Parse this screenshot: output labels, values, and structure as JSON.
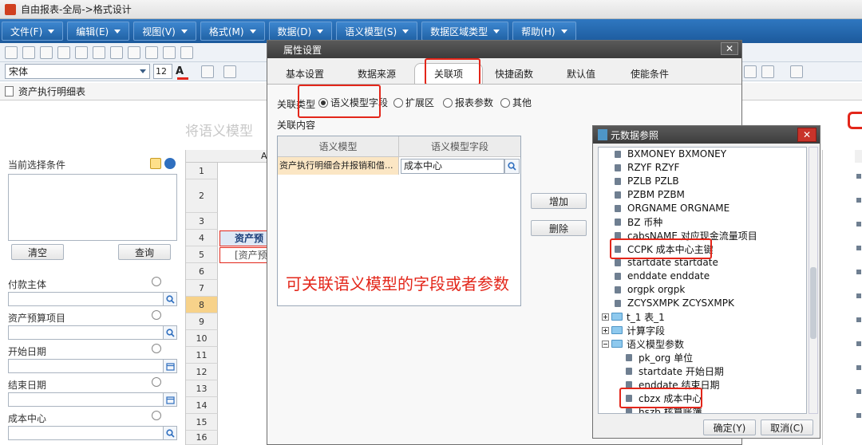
{
  "window": {
    "title": "自由报表-全局->格式设计"
  },
  "menu": [
    {
      "label": "文件(F)"
    },
    {
      "label": "编辑(E)"
    },
    {
      "label": "视图(V)"
    },
    {
      "label": "格式(M)"
    },
    {
      "label": "数据(D)"
    },
    {
      "label": "语义模型(S)"
    },
    {
      "label": "数据区域类型"
    },
    {
      "label": "帮助(H)"
    }
  ],
  "fontbar": {
    "font": "宋体",
    "size": "12"
  },
  "report_tab": {
    "label": "资产执行明细表"
  },
  "background_title": "将语义模型",
  "left_panel": {
    "current_conditions_label": "当前选择条件",
    "clear_label": "清空",
    "query_label": "查询",
    "params": [
      {
        "label": "付款主体",
        "picker": "date"
      },
      {
        "label": "资产预算项目",
        "picker": "date"
      },
      {
        "label": "开始日期",
        "picker": "calendar"
      },
      {
        "label": "结束日期",
        "picker": "calendar"
      },
      {
        "label": "成本中心",
        "picker": "date"
      }
    ]
  },
  "grid": {
    "col_label": "A",
    "rows": [
      "1",
      "2",
      "3",
      "4",
      "5",
      "6",
      "7",
      "8",
      "9",
      "10",
      "11",
      "12",
      "13",
      "14",
      "15",
      "16"
    ],
    "cells": {
      "r4": "资产预",
      "r5": "[资产预"
    }
  },
  "dialog": {
    "title": "属性设置",
    "tabs": [
      {
        "label": "基本设置"
      },
      {
        "label": "数据来源"
      },
      {
        "label": "关联项",
        "active": true
      },
      {
        "label": "快捷函数"
      },
      {
        "label": "默认值"
      },
      {
        "label": "使能条件"
      }
    ],
    "relation_type_label": "关联类型",
    "relation_options": [
      {
        "label": "语义模型字段",
        "checked": true
      },
      {
        "label": "扩展区",
        "checked": false
      },
      {
        "label": "报表参数",
        "checked": false
      },
      {
        "label": "其他",
        "checked": false
      }
    ],
    "relation_content_label": "关联内容",
    "table_headers": [
      "语义模型",
      "语义模型字段"
    ],
    "table_row": {
      "model": "资产执行明细合并报销和借...",
      "field": "成本中心"
    },
    "add_label": "增加",
    "delete_label": "删除",
    "annotation": "可关联语义模型的字段或者参数"
  },
  "metadata_dialog": {
    "title": "元数据参照",
    "items": [
      {
        "label": "BXMONEY  BXMONEY",
        "kind": "leaf",
        "indent": 1
      },
      {
        "label": "RZYF  RZYF",
        "kind": "leaf",
        "indent": 1
      },
      {
        "label": "PZLB  PZLB",
        "kind": "leaf",
        "indent": 1
      },
      {
        "label": "PZBM  PZBM",
        "kind": "leaf",
        "indent": 1
      },
      {
        "label": "ORGNAME  ORGNAME",
        "kind": "leaf",
        "indent": 1
      },
      {
        "label": "BZ  币种",
        "kind": "leaf",
        "indent": 1
      },
      {
        "label": "cabsNAME  对应现金流量项目",
        "kind": "leaf",
        "indent": 1
      },
      {
        "label": "CCPK  成本中心主键",
        "kind": "leaf",
        "indent": 1,
        "highlight": true
      },
      {
        "label": "startdate  startdate",
        "kind": "leaf",
        "indent": 1
      },
      {
        "label": "enddate  enddate",
        "kind": "leaf",
        "indent": 1
      },
      {
        "label": "orgpk  orgpk",
        "kind": "leaf",
        "indent": 1
      },
      {
        "label": "ZCYSXMPK  ZCYSXMPK",
        "kind": "leaf",
        "indent": 1
      },
      {
        "label": "t_1  表_1",
        "kind": "folder",
        "indent": 0,
        "expanded": false
      },
      {
        "label": "计算字段",
        "kind": "folder",
        "indent": 0,
        "expanded": false
      },
      {
        "label": "语义模型参数",
        "kind": "folder",
        "indent": 0,
        "expanded": true
      },
      {
        "label": "pk_org  单位",
        "kind": "leaf",
        "indent": 1
      },
      {
        "label": "startdate  开始日期",
        "kind": "leaf",
        "indent": 1
      },
      {
        "label": "enddate  结束日期",
        "kind": "leaf",
        "indent": 1
      },
      {
        "label": "cbzx  成本中心",
        "kind": "leaf",
        "indent": 1,
        "highlight": true
      },
      {
        "label": "hszb  核算账簿",
        "kind": "leaf",
        "indent": 1
      }
    ],
    "ok_label": "确定(Y)",
    "cancel_label": "取消(C)"
  },
  "colors": {
    "menu_blue": "#2163a6",
    "annotation_red": "#e3261a",
    "dialog_title": "#3c3c3c"
  }
}
